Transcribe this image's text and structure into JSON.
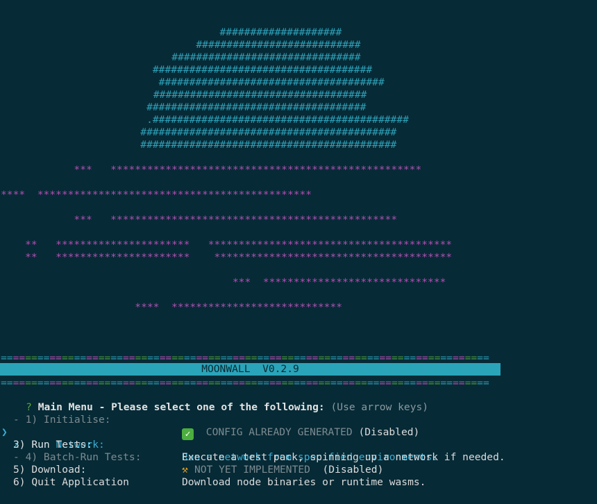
{
  "ascii_art": {
    "hash_lines": [
      "                                   ####################",
      "                               ###########################",
      "                           ###############################",
      "                        ####################################",
      "                         #####################################",
      "                        ###################################",
      "                       ####################################",
      "                       .##########################################",
      "                      ##########################################",
      "                      ##########################################"
    ],
    "star_lines": [
      "            ***   ***************************************************",
      "****  *********************************************",
      "            ***   ***********************************************",
      "    **   **********************   ****************************************",
      "    **   **********************    ***************************************",
      "                                      ***  ******************************",
      "                      ****  ****************************"
    ]
  },
  "separator": "================================================================================",
  "banner": {
    "title": "MOONWALL  V0.2.9"
  },
  "prompt": {
    "question_mark": "?",
    "text": "Main Menu - Please select one of the following:",
    "hint": "(Use arrow keys)"
  },
  "pointer": "❯",
  "menu": [
    {
      "label": "- 1) Initialise:",
      "desc": "CONFIG ALREADY GENERATED",
      "suffix": "(Disabled)",
      "icon": "check-icon"
    },
    {
      "label": "2) Run Network:",
      "desc": "Run a network from specified environments.",
      "suffix": "",
      "icon": ""
    },
    {
      "label": "3) Run Tests:",
      "desc": "Execute a test pack, spinning up a network if needed.",
      "suffix": "",
      "icon": ""
    },
    {
      "label": "- 4) Batch-Run Tests:",
      "desc": "NOT YET IMPLEMENTED",
      "suffix": "(Disabled)",
      "icon": "construction-icon"
    },
    {
      "label": "5) Download:",
      "desc": "Download node binaries or runtime wasms.",
      "suffix": "",
      "icon": ""
    },
    {
      "label": "6) Quit Application",
      "desc": "",
      "suffix": "",
      "icon": ""
    }
  ],
  "icons": {
    "check": "✓",
    "crane": "⚒"
  },
  "colors": {
    "background": "#062a36",
    "selected": "#3aaed3",
    "banner": "#2aa4b9",
    "ascii_hash": "#2e9fb6",
    "ascii_star": "#b34fb3"
  }
}
